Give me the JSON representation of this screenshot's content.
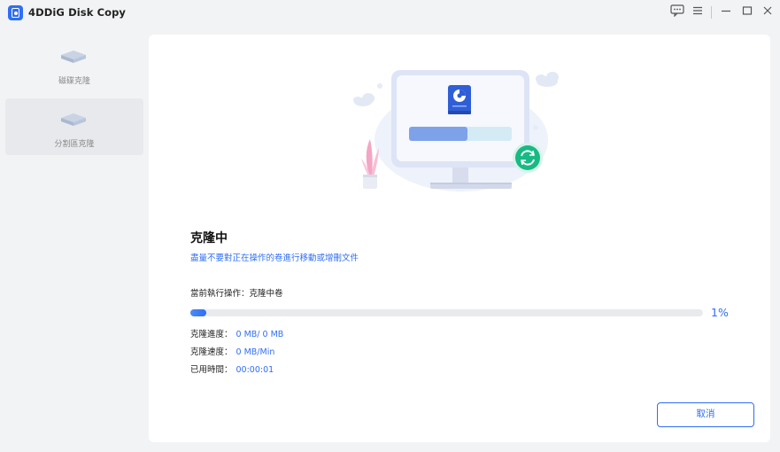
{
  "app": {
    "title": "4DDiG Disk Copy"
  },
  "titlebar": {
    "icons": [
      "feedback-icon",
      "menu-icon",
      "minimize-icon",
      "maximize-icon",
      "close-icon"
    ]
  },
  "sidebar": {
    "items": [
      {
        "label": "磁碟克隆",
        "icon": "disk-icon",
        "active": false
      },
      {
        "label": "分割區克隆",
        "icon": "disk-icon",
        "active": true
      }
    ]
  },
  "main": {
    "heading": "克隆中",
    "warning": "盡量不要對正在操作的卷進行移動或增刪文件",
    "current_op_label": "當前執行操作：",
    "current_op_value": "克隆中卷",
    "progress_percent": 1,
    "progress_label": "1%",
    "stats": [
      {
        "label": "克隆進度：",
        "value": "0 MB/ 0 MB"
      },
      {
        "label": "克隆速度：",
        "value": "0 MB/Min"
      },
      {
        "label": "已用時間：",
        "value": "00:00:01"
      }
    ],
    "cancel_label": "取消"
  },
  "colors": {
    "accent": "#2f6ef5",
    "background": "#f2f3f5",
    "panel": "#ffffff",
    "success": "#18b985"
  }
}
